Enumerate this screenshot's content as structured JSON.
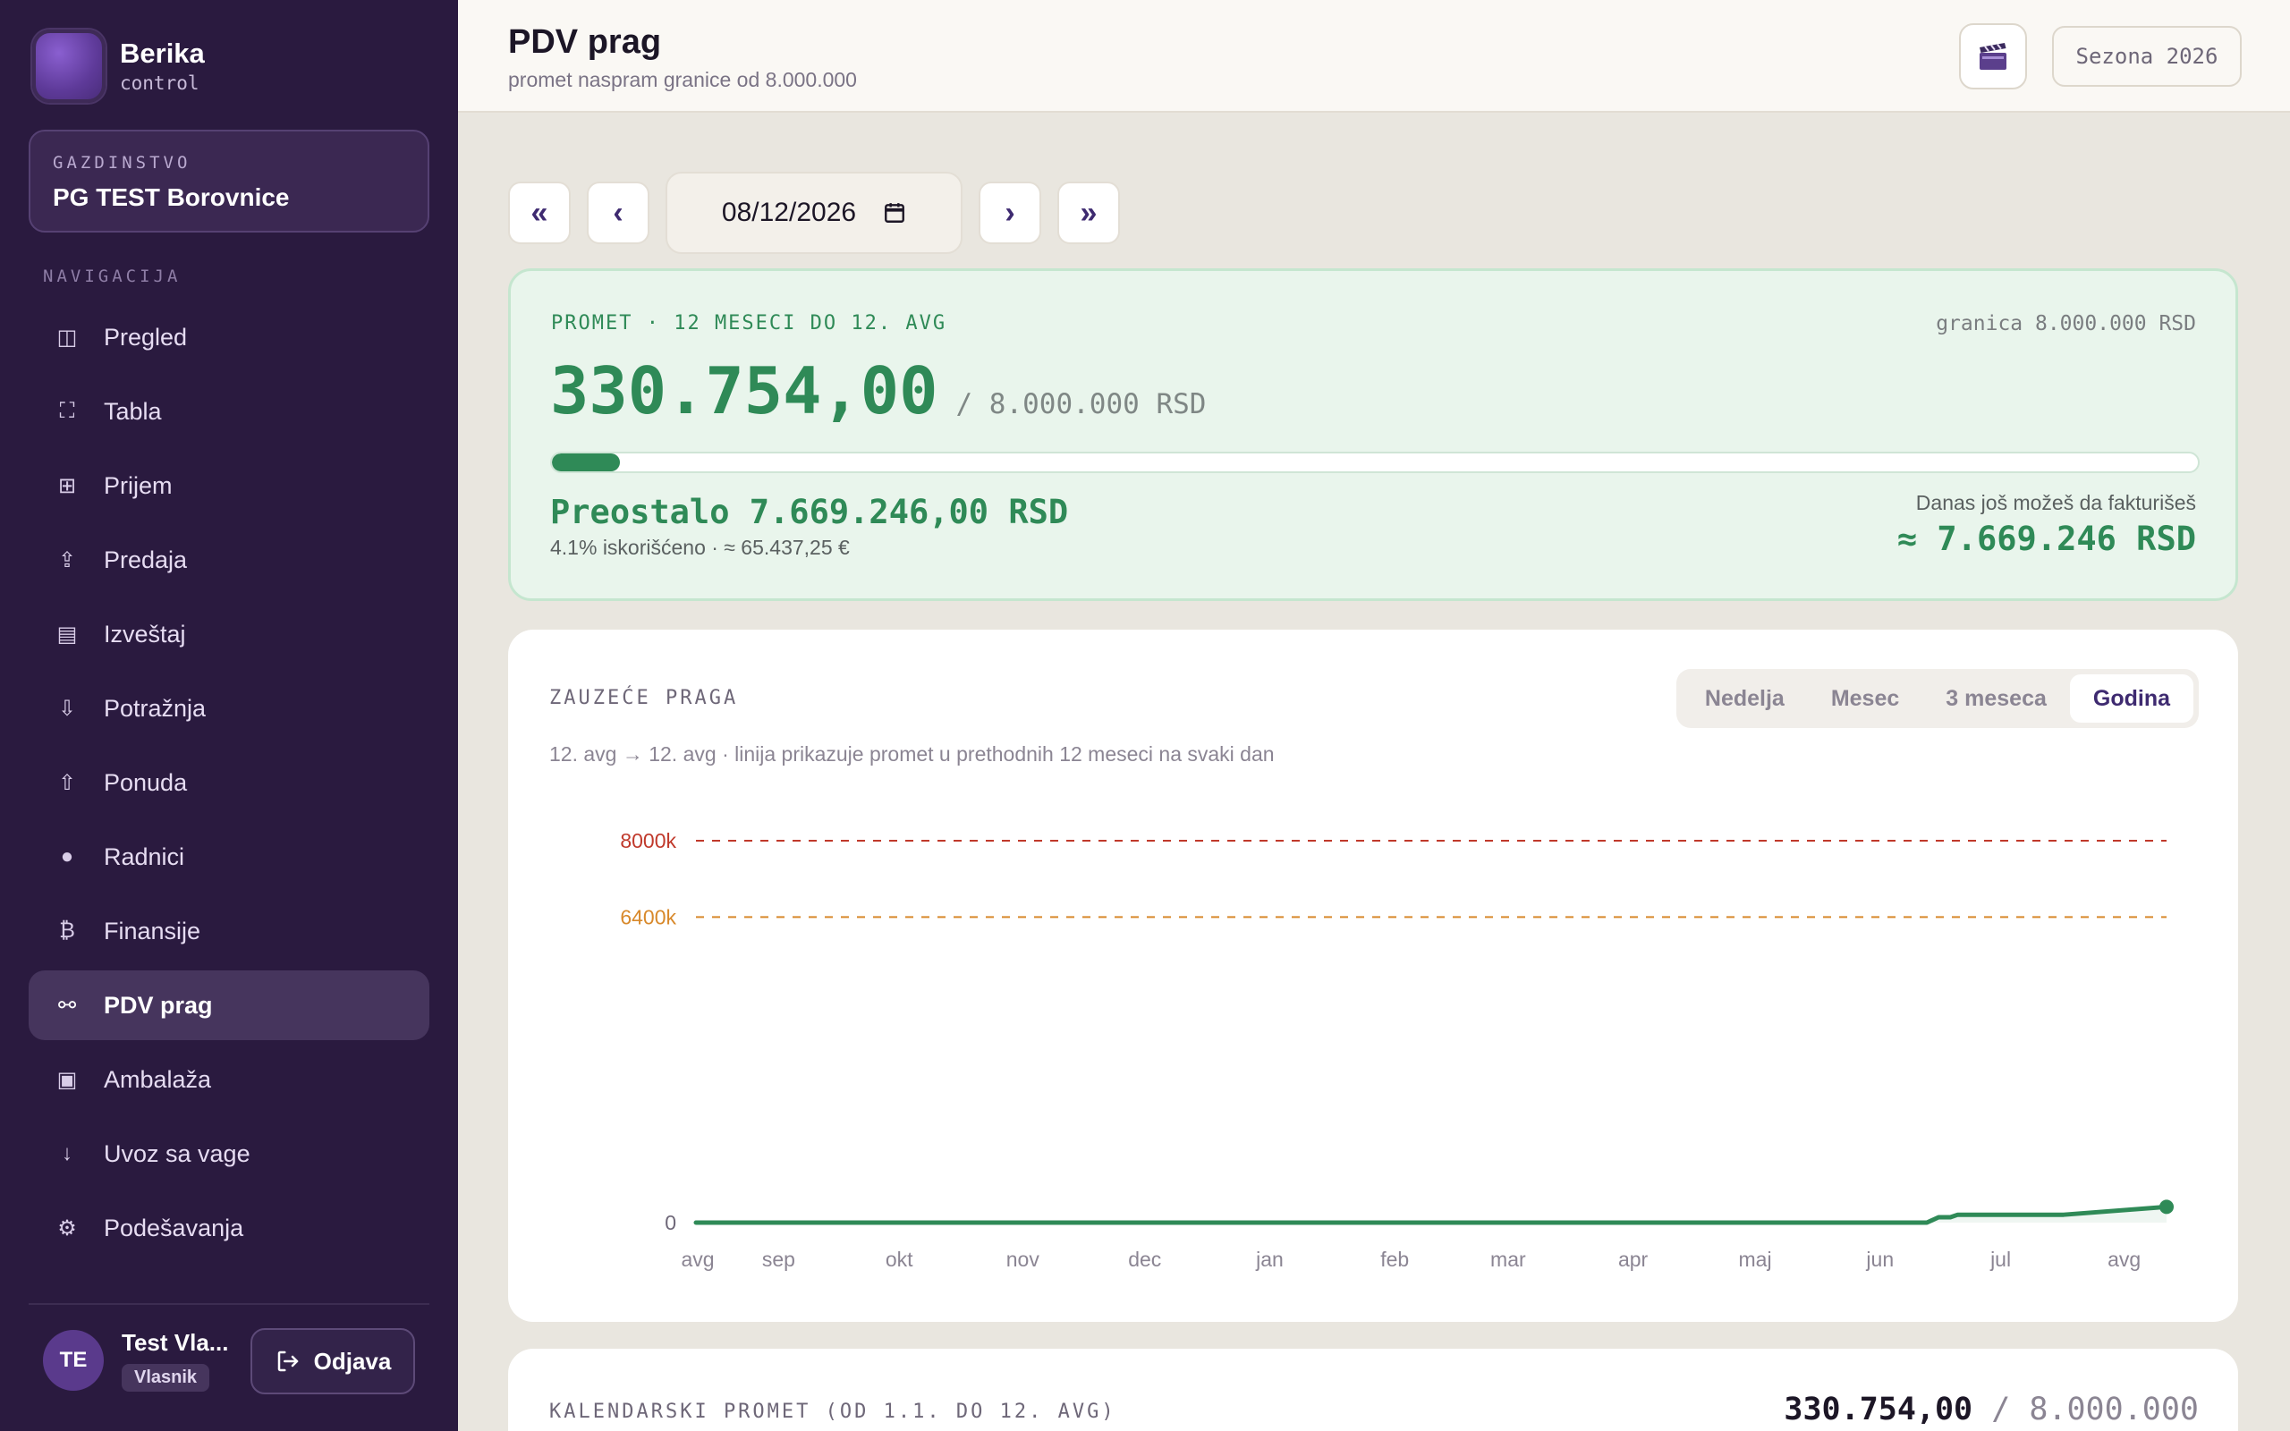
{
  "brand": {
    "name": "Berika",
    "sub": "control"
  },
  "farm": {
    "label": "GAZDINSTVO",
    "name": "PG TEST Borovnice"
  },
  "nav": {
    "title": "NAVIGACIJA",
    "items": [
      {
        "label": "Pregled",
        "icon": "columns-icon",
        "glyph": "◫",
        "active": false
      },
      {
        "label": "Tabla",
        "icon": "scan-frame-icon",
        "glyph": "⛶",
        "active": false
      },
      {
        "label": "Prijem",
        "icon": "grid-icon",
        "glyph": "⊞",
        "active": false
      },
      {
        "label": "Predaja",
        "icon": "upload-arrow-icon",
        "glyph": "⇪",
        "active": false
      },
      {
        "label": "Izveštaj",
        "icon": "report-icon",
        "glyph": "▤",
        "active": false
      },
      {
        "label": "Potražnja",
        "icon": "arrow-down-icon",
        "glyph": "⇩",
        "active": false
      },
      {
        "label": "Ponuda",
        "icon": "arrow-up-icon",
        "glyph": "⇧",
        "active": false
      },
      {
        "label": "Radnici",
        "icon": "circle-dot-icon",
        "glyph": "●",
        "active": false
      },
      {
        "label": "Finansije",
        "icon": "currency-icon",
        "glyph": "₿",
        "active": false
      },
      {
        "label": "PDV prag",
        "icon": "binoculars-icon",
        "glyph": "⚯",
        "active": true
      },
      {
        "label": "Ambalaža",
        "icon": "package-icon",
        "glyph": "▣",
        "active": false
      },
      {
        "label": "Uvoz sa vage",
        "icon": "import-arrow-icon",
        "glyph": "↓",
        "active": false
      },
      {
        "label": "Podešavanja",
        "icon": "gear-icon",
        "glyph": "⚙",
        "active": false
      }
    ]
  },
  "user": {
    "initials": "TE",
    "name": "Test Vla...",
    "role": "Vlasnik",
    "logout_label": "Odjava"
  },
  "header": {
    "title": "PDV prag",
    "subtitle": "promet naspram granice od 8.000.000",
    "season_label": "Sezona 2026"
  },
  "date_nav": {
    "first": "«",
    "prev": "‹",
    "next": "›",
    "last": "»",
    "date_value": "08/12/2026"
  },
  "turnover": {
    "label": "PROMET · 12 MESECI DO 12. AVG",
    "limit_text": "granica 8.000.000 RSD",
    "amount": "330.754,00",
    "of_text": "/ 8.000.000 RSD",
    "progress_fraction": 0.041,
    "remaining": "Preostalo 7.669.246,00 RSD",
    "used": "4.1% iskorišćeno · ≈ 65.437,25 €",
    "today_label": "Danas još možeš da fakturišeš",
    "today_value": "≈ 7.669.246 RSD"
  },
  "chart": {
    "title": "ZAUZEĆE PRAGA",
    "subtitle": "12. avg → 12. avg · linija prikazuje promet u prethodnih 12 meseci na svaki dan",
    "tabs": [
      {
        "label": "Nedelja",
        "active": false
      },
      {
        "label": "Mesec",
        "active": false
      },
      {
        "label": "3 meseca",
        "active": false
      },
      {
        "label": "Godina",
        "active": true
      }
    ]
  },
  "chart_data": {
    "type": "line",
    "xlabel": "",
    "ylabel": "",
    "ylim": [
      0,
      8000000
    ],
    "y_ticks": [
      {
        "label": "8000k",
        "value": 8000000,
        "color": "#c0392b",
        "dashed": true
      },
      {
        "label": "6400k",
        "value": 6400000,
        "color": "#d8892b",
        "dashed": true
      },
      {
        "label": "0",
        "value": 0,
        "color": "#6e6778",
        "dashed": false
      }
    ],
    "x_ticks": [
      {
        "label": "avg",
        "value": 0
      },
      {
        "label": "sep",
        "value": 0.055
      },
      {
        "label": "okt",
        "value": 0.137
      },
      {
        "label": "nov",
        "value": 0.221
      },
      {
        "label": "dec",
        "value": 0.304
      },
      {
        "label": "jan",
        "value": 0.389
      },
      {
        "label": "feb",
        "value": 0.474
      },
      {
        "label": "mar",
        "value": 0.551
      },
      {
        "label": "apr",
        "value": 0.636
      },
      {
        "label": "maj",
        "value": 0.719
      },
      {
        "label": "jun",
        "value": 0.804
      },
      {
        "label": "jul",
        "value": 0.886
      },
      {
        "label": "avg",
        "value": 0.97
      }
    ],
    "series": [
      {
        "color": "#2f8a57",
        "points": [
          {
            "x": 0,
            "y": 0
          },
          {
            "x": 0.837,
            "y": 0
          },
          {
            "x": 0.845,
            "y": 112000
          },
          {
            "x": 0.853,
            "y": 112000
          },
          {
            "x": 0.858,
            "y": 165000
          },
          {
            "x": 0.905,
            "y": 165000
          },
          {
            "x": 0.93,
            "y": 165000
          },
          {
            "x": 1.0,
            "y": 330754
          }
        ]
      }
    ]
  },
  "calendar": {
    "title": "KALENDARSKI PROMET (OD 1.1. DO 12. AVG)",
    "value": "330.754,00",
    "limit": "/ 8.000.000"
  }
}
